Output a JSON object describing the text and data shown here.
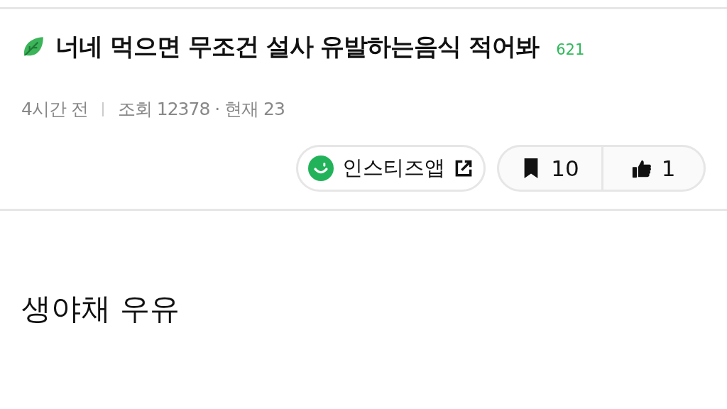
{
  "post": {
    "title": "너네 먹으면 무조건 설사 유발하는음식 적어봐",
    "comment_count": "621",
    "time": "4시간 전",
    "views": "조회 12378 · 현재 23",
    "app_button": "인스티즈앱",
    "bookmark_count": "10",
    "like_count": "1",
    "body": "생야채 우유"
  }
}
